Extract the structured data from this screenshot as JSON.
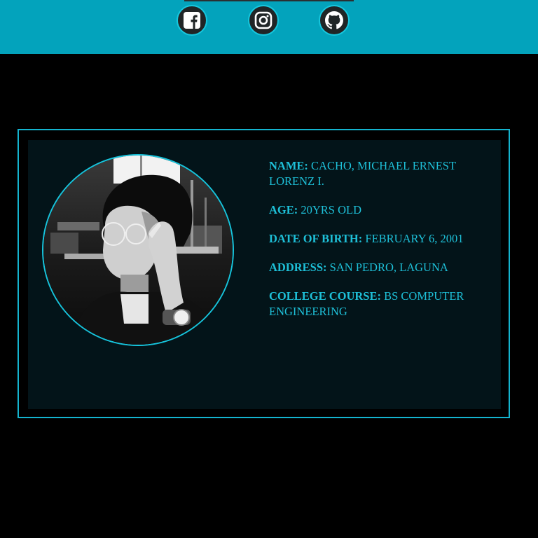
{
  "social": [
    {
      "name": "facebook",
      "icon": "facebook-icon"
    },
    {
      "name": "instagram",
      "icon": "instagram-icon"
    },
    {
      "name": "github",
      "icon": "github-icon"
    }
  ],
  "profile": {
    "photo_alt": "profile photo",
    "fields": [
      {
        "label": "NAME:",
        "value": "CACHO, MICHAEL ERNEST LORENZ I."
      },
      {
        "label": "AGE:",
        "value": "20YRS OLD"
      },
      {
        "label": "DATE OF BIRTH:",
        "value": "FEBRUARY 6, 2001"
      },
      {
        "label": "ADDRESS:",
        "value": "SAN PEDRO, LAGUNA"
      },
      {
        "label": "COLLEGE COURSE:",
        "value": "BS COMPUTER ENGINEERING"
      }
    ]
  },
  "colors": {
    "header": "#03a3bc",
    "accent": "#1ec0d8",
    "card": "#031419",
    "background": "#000000"
  }
}
